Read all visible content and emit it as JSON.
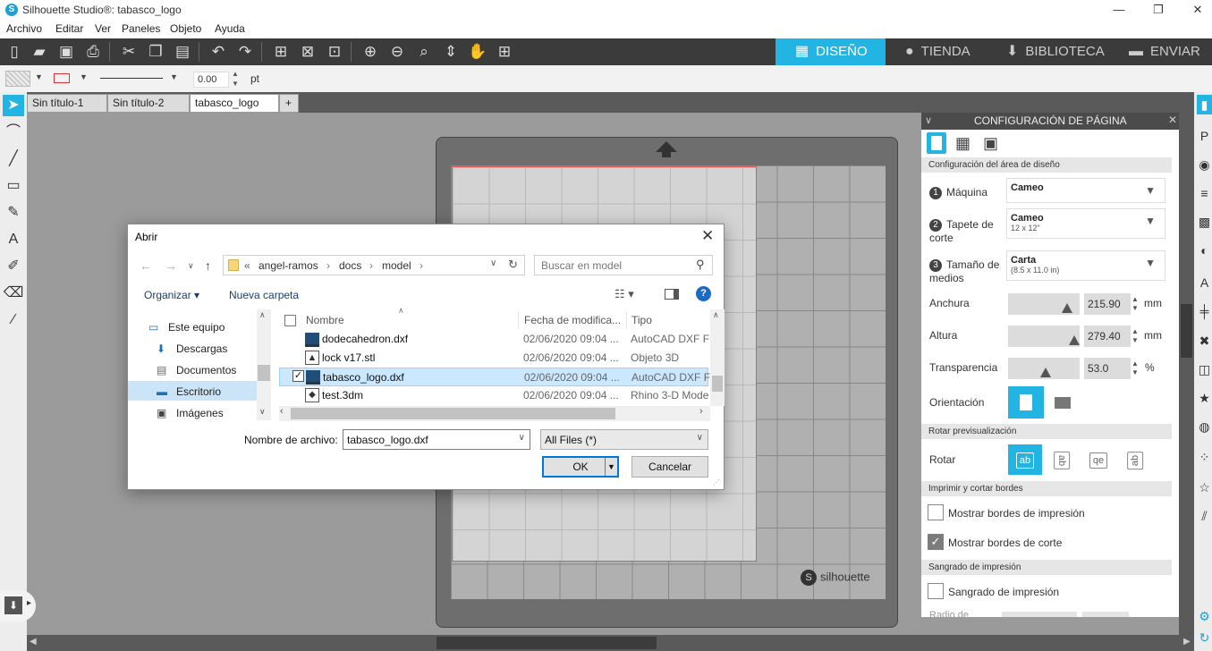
{
  "window": {
    "title": "Silhouette Studio®: tabasco_logo",
    "app_icon": "S",
    "minimize": "—",
    "maximize": "❐",
    "close": "✕"
  },
  "menu": [
    "Archivo",
    "Editar",
    "Ver",
    "Paneles",
    "Objeto",
    "Ayuda"
  ],
  "nav_tabs": {
    "design": "DISEÑO",
    "store": "TIENDA",
    "library": "BIBLIOTECA",
    "send": "ENVIAR"
  },
  "propbar": {
    "line_width_value": "0.00",
    "unit": "pt"
  },
  "doc_tabs": [
    "Sin título-1",
    "Sin título-2",
    "tabasco_logo"
  ],
  "add_tab": "+",
  "mat_brand": "silhouette",
  "panel": {
    "title": "CONFIGURACIÓN DE PÁGINA",
    "section_design_area": "Configuración del área de diseño",
    "machine_label": "Máquina",
    "machine_value": "Cameo",
    "mat_label": "Tapete de corte",
    "mat_value": "Cameo",
    "mat_sub": "12 x 12\"",
    "media_label": "Tamaño de medios",
    "media_value": "Carta",
    "media_sub": "(8.5 x 11.0 in)",
    "width_label": "Anchura",
    "width_value": "215.90",
    "height_label": "Altura",
    "height_value": "279.40",
    "unit_mm": "mm",
    "transparency_label": "Transparencia",
    "transparency_value": "53.0",
    "unit_pct": "%",
    "transparency_level": 0.53,
    "orientation_label": "Orientación",
    "section_rotate": "Rotar previsualización",
    "rotate_label": "Rotar",
    "rotate_options": [
      "ab",
      "ab",
      "qe",
      "ab"
    ],
    "section_borders": "Imprimir y cortar bordes",
    "show_print_borders": "Mostrar bordes de impresión",
    "show_cut_borders": "Mostrar bordes de corte",
    "section_bleed": "Sangrado de impresión",
    "bleed_label": "Sangrado de impresión",
    "bleed_radius_partial": "Radio de"
  },
  "dialog": {
    "title": "Abrir",
    "path": [
      "«",
      "angel-ramos",
      "›",
      "docs",
      "›",
      "model",
      "›"
    ],
    "search_placeholder": "Buscar en model",
    "organize": "Organizar ▾",
    "new_folder": "Nueva carpeta",
    "nav_items": [
      "Este equipo",
      "Descargas",
      "Documentos",
      "Escritorio",
      "Imágenes"
    ],
    "columns": {
      "name": "Nombre",
      "date": "Fecha de modifica...",
      "type": "Tipo"
    },
    "files": [
      {
        "name": "dodecahedron.dxf",
        "date": "02/06/2020 09:04 ...",
        "type": "AutoCAD DXF Fo"
      },
      {
        "name": "lock v17.stl",
        "date": "02/06/2020 09:04 ...",
        "type": "Objeto 3D"
      },
      {
        "name": "tabasco_logo.dxf",
        "date": "02/06/2020 09:04 ...",
        "type": "AutoCAD DXF Fo"
      },
      {
        "name": "test.3dm",
        "date": "02/06/2020 09:04 ...",
        "type": "Rhino 3-D Mode"
      }
    ],
    "filename_label": "Nombre de archivo:",
    "filename_value": "tabasco_logo.dxf",
    "filetype_value": "All Files (*)",
    "ok": "OK",
    "cancel": "Cancelar"
  },
  "colors": {
    "accent": "#22b5e4",
    "toolbar": "#3b3b3b",
    "selection": "#cce8ff"
  }
}
